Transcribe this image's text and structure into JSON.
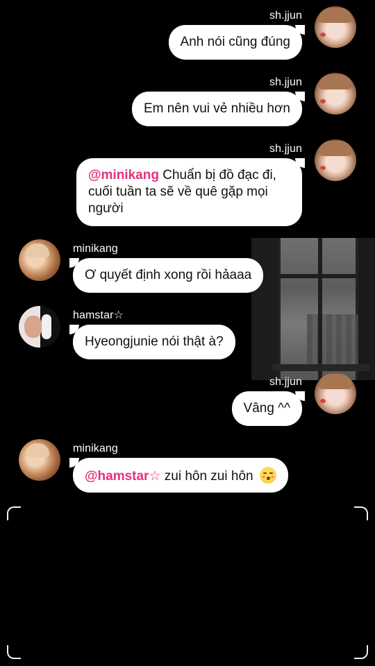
{
  "messages": [
    {
      "user": "sh.jjun",
      "side": "right",
      "mention": "",
      "text": "Anh nói cũng đúng"
    },
    {
      "user": "sh.jjun",
      "side": "right",
      "mention": "",
      "text": "Em nên vui vẻ nhiều hơn"
    },
    {
      "user": "sh.jjun",
      "side": "right",
      "mention": "@minikang",
      "text": "Chuẩn bị đồ đạc đi, cuối tuần ta sẽ về quê gặp mọi người"
    },
    {
      "user": "minikang",
      "side": "left",
      "mention": "",
      "text": "Ơ quyết định xong rồi hảaaa"
    },
    {
      "user": "hamstar☆",
      "side": "left",
      "mention": "",
      "text": "Hyeongjunie nói thật à?"
    },
    {
      "user": "sh.jjun",
      "side": "right",
      "mention": "",
      "text": "Vâng ^^"
    },
    {
      "user": "minikang",
      "side": "left",
      "mention": "@hamstar☆",
      "text": "zui hôn zui hôn",
      "emoji": "kissing-face-icon"
    }
  ],
  "colors": {
    "mention": "#e3327c",
    "bubble": "#ffffff",
    "background": "#000000"
  }
}
